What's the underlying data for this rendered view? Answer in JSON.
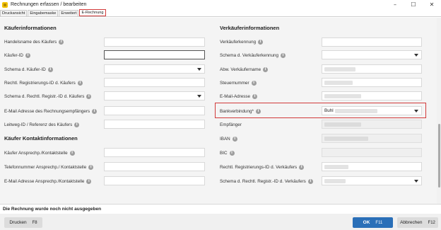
{
  "window": {
    "title": "Rechnungen erfassen / bearbeiten",
    "controls": [
      "–",
      "☐",
      "✕"
    ]
  },
  "tabs": [
    {
      "label": "Druckansicht"
    },
    {
      "label": "Eingabemaske"
    },
    {
      "label": "Erweitert"
    },
    {
      "label": "E-Rechnung"
    }
  ],
  "buyer": {
    "section_title": "Käuferinformationen",
    "fields": [
      {
        "label": "Handelsname des Käufers",
        "type": "text",
        "value": ""
      },
      {
        "label": "Käufer-ID",
        "type": "text",
        "value": ""
      },
      {
        "label": "Schema d. Käufer-ID",
        "type": "select",
        "value": ""
      },
      {
        "label": "Rechtl. Registrierungs-ID d. Käufers",
        "type": "text",
        "value": ""
      },
      {
        "label": "Schema d. Rechtl. Registr.-ID d. Käufers",
        "type": "select",
        "value": ""
      },
      {
        "label": "E-Mail Adresse des Rechnungsempfängers",
        "type": "text",
        "value": ""
      },
      {
        "label": "Leitweg-ID / Referenz des Käufers",
        "type": "text",
        "value": ""
      }
    ],
    "contact_section_title": "Käufer Kontaktinformationen",
    "contact_fields": [
      {
        "label": "Käufer Ansprechp./Kontaktstelle",
        "type": "text",
        "value": ""
      },
      {
        "label": "Telefonnummer Ansprechp./ Kontaktstelle",
        "type": "text",
        "value": ""
      },
      {
        "label": "E-Mail Adresse Ansprechp./Kontaktstelle",
        "type": "text",
        "value": ""
      }
    ]
  },
  "seller": {
    "section_title": "Verkäuferinformationen",
    "fields": [
      {
        "label": "Verkäuferkennung",
        "type": "text",
        "value": ""
      },
      {
        "label": "Schema d. Verkäuferkennung",
        "type": "select",
        "value": ""
      },
      {
        "label": "Abw. Verkäufername",
        "type": "text",
        "value": ""
      },
      {
        "label": "Steuernummer",
        "type": "text",
        "value": ""
      },
      {
        "label": "E-Mail-Adresse",
        "type": "text",
        "value": ""
      },
      {
        "label": "Bankverbindung*",
        "type": "select",
        "value": "Buhl"
      },
      {
        "label": "Empfänger",
        "type": "disabled",
        "value": ""
      },
      {
        "label": "IBAN",
        "type": "disabled",
        "value": ""
      },
      {
        "label": "BIC",
        "type": "disabled",
        "value": ""
      },
      {
        "label": "Rechtl. Registrierungs-ID d. Verkäufers",
        "type": "text",
        "value": ""
      },
      {
        "label": "Schema d. Rechtl. Registr.-ID d. Verkäufers",
        "type": "select",
        "value": ""
      }
    ]
  },
  "status": {
    "message": "Die Rechnung wurde noch nicht ausgegeben"
  },
  "footer": {
    "print_label": "Drucken",
    "print_key": "F8",
    "ok_label": "OK",
    "ok_key": "F11",
    "cancel_label": "Abbrechen",
    "cancel_key": "F12"
  },
  "colors": {
    "accent": "#2a6fb8",
    "highlight": "#d23a3a",
    "app_icon": "#f2c200"
  }
}
